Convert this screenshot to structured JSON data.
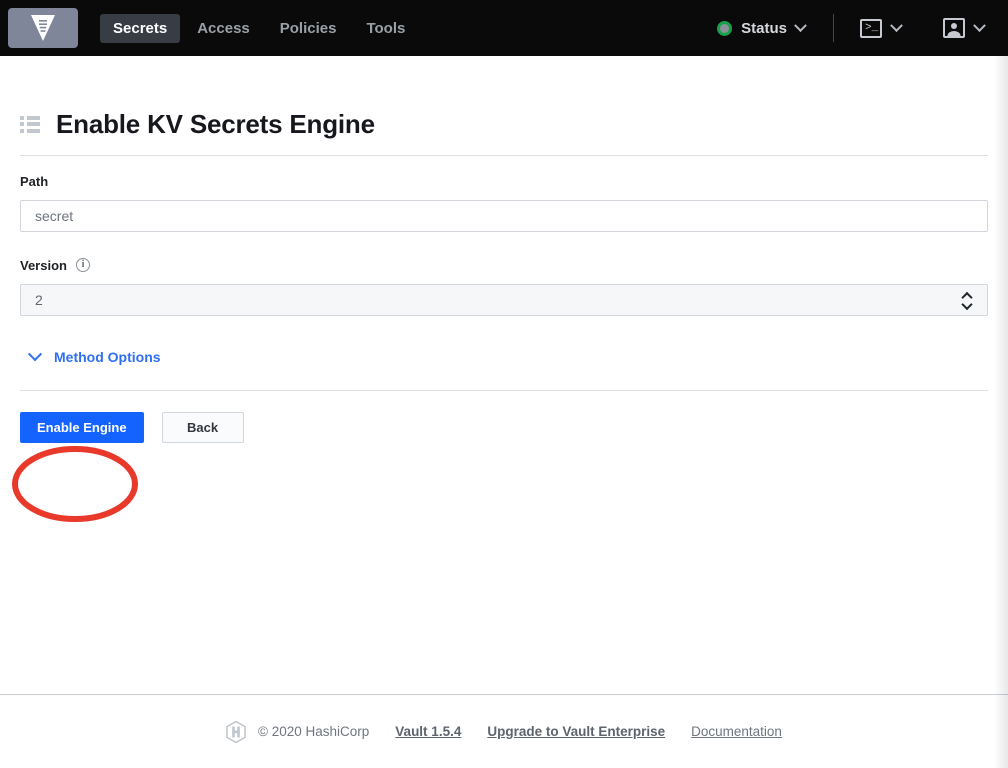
{
  "navbar": {
    "logo_icon": "vault-logo-icon",
    "tabs": [
      {
        "label": "Secrets",
        "active": true
      },
      {
        "label": "Access",
        "active": false
      },
      {
        "label": "Policies",
        "active": false
      },
      {
        "label": "Tools",
        "active": false
      }
    ],
    "status": {
      "label": "Status",
      "indicator_icon": "green-status-dot-icon",
      "indicator_color": "#17a14b",
      "chevron_icon": "chevron-down-icon"
    },
    "console": {
      "icon": "terminal-console-icon",
      "prompt_glyph": ">_",
      "chevron_icon": "chevron-down-icon"
    },
    "user": {
      "icon": "user-account-icon",
      "chevron_icon": "chevron-down-icon"
    },
    "background_color": "#0a0a0a",
    "active_tab_color": "#373c45"
  },
  "page": {
    "title": "Enable KV Secrets Engine",
    "title_icon": "list-items-icon"
  },
  "form": {
    "path": {
      "label": "Path",
      "value": "",
      "placeholder": "secret"
    },
    "version": {
      "label": "Version",
      "info_icon": "info-circle-icon",
      "info_glyph": "i",
      "value": "2",
      "stepper_icon": "up-down-stepper-icon"
    },
    "method_options": {
      "label": "Method Options",
      "chevron_icon": "chevron-down-icon",
      "expanded": false,
      "color": "#2f6ff5"
    }
  },
  "actions": {
    "primary": {
      "label": "Enable Engine",
      "color": "#1563ff"
    },
    "secondary": {
      "label": "Back"
    }
  },
  "annotation": {
    "shape": "ellipse-highlight",
    "color": "#e8392b",
    "target": "Enable Engine"
  },
  "footer": {
    "logo_icon": "hashicorp-logo-icon",
    "copyright": "© 2020 HashiCorp",
    "links": [
      {
        "label": "Vault 1.5.4",
        "strong": true
      },
      {
        "label": "Upgrade to Vault Enterprise",
        "strong": true
      },
      {
        "label": "Documentation",
        "strong": false
      }
    ]
  }
}
